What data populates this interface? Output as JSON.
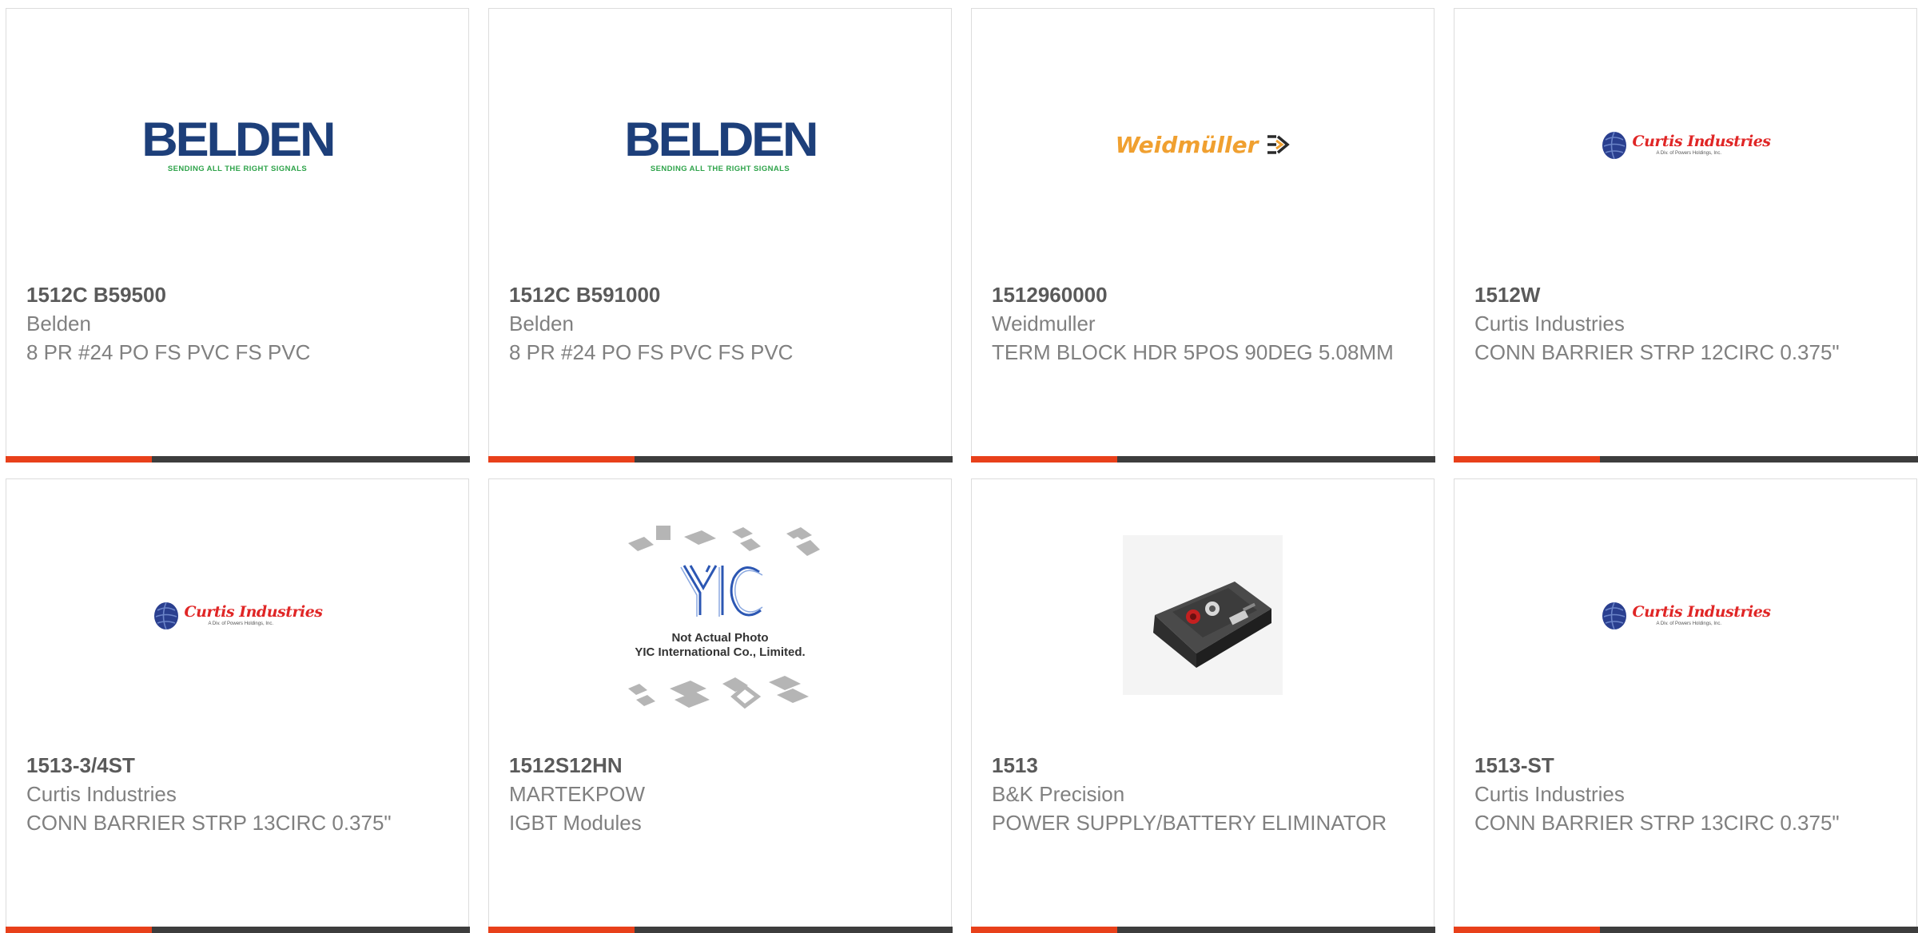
{
  "products": [
    {
      "part_number": "1512C B59500",
      "manufacturer": "Belden",
      "description": "8 PR #24 PO FS PVC FS PVC",
      "image": "belden-logo",
      "logo_text": "BELDEN",
      "logo_tagline": "SENDING ALL THE RIGHT SIGNALS"
    },
    {
      "part_number": "1512C B591000",
      "manufacturer": "Belden",
      "description": "8 PR #24 PO FS PVC FS PVC",
      "image": "belden-logo",
      "logo_text": "BELDEN",
      "logo_tagline": "SENDING ALL THE RIGHT SIGNALS"
    },
    {
      "part_number": "1512960000",
      "manufacturer": "Weidmuller",
      "description": "TERM BLOCK HDR 5POS 90DEG 5.08MM",
      "image": "weidmuller-logo",
      "logo_text": "Weidmüller"
    },
    {
      "part_number": "1512W",
      "manufacturer": "Curtis Industries",
      "description": "CONN BARRIER STRP 12CIRC 0.375\"",
      "image": "curtis-logo",
      "logo_text": "Curtis Industries",
      "logo_tagline": "A Div. of Powers Holdings, Inc."
    },
    {
      "part_number": "1513-3/4ST",
      "manufacturer": "Curtis Industries",
      "description": "CONN BARRIER STRP 13CIRC 0.375\"",
      "image": "curtis-logo",
      "logo_text": "Curtis Industries",
      "logo_tagline": "A Div. of Powers Holdings, Inc."
    },
    {
      "part_number": "1512S12HN",
      "manufacturer": "MARTEKPOW",
      "description": "IGBT Modules",
      "image": "yic-placeholder",
      "logo_text": "YIC",
      "caption_line1": "Not Actual Photo",
      "caption_line2": "YIC International Co., Limited."
    },
    {
      "part_number": "1513",
      "manufacturer": "B&K Precision",
      "description": "POWER SUPPLY/BATTERY ELIMINATOR",
      "image": "power-supply-photo"
    },
    {
      "part_number": "1513-ST",
      "manufacturer": "Curtis Industries",
      "description": "CONN BARRIER STRP 13CIRC 0.375\"",
      "image": "curtis-logo",
      "logo_text": "Curtis Industries",
      "logo_tagline": "A Div. of Powers Holdings, Inc."
    }
  ],
  "colors": {
    "accent": "#e8401a",
    "bar": "#3d3d3d",
    "part_number": "#5a5a5a",
    "body_text": "#808080",
    "card_border": "#dcdcdc"
  }
}
